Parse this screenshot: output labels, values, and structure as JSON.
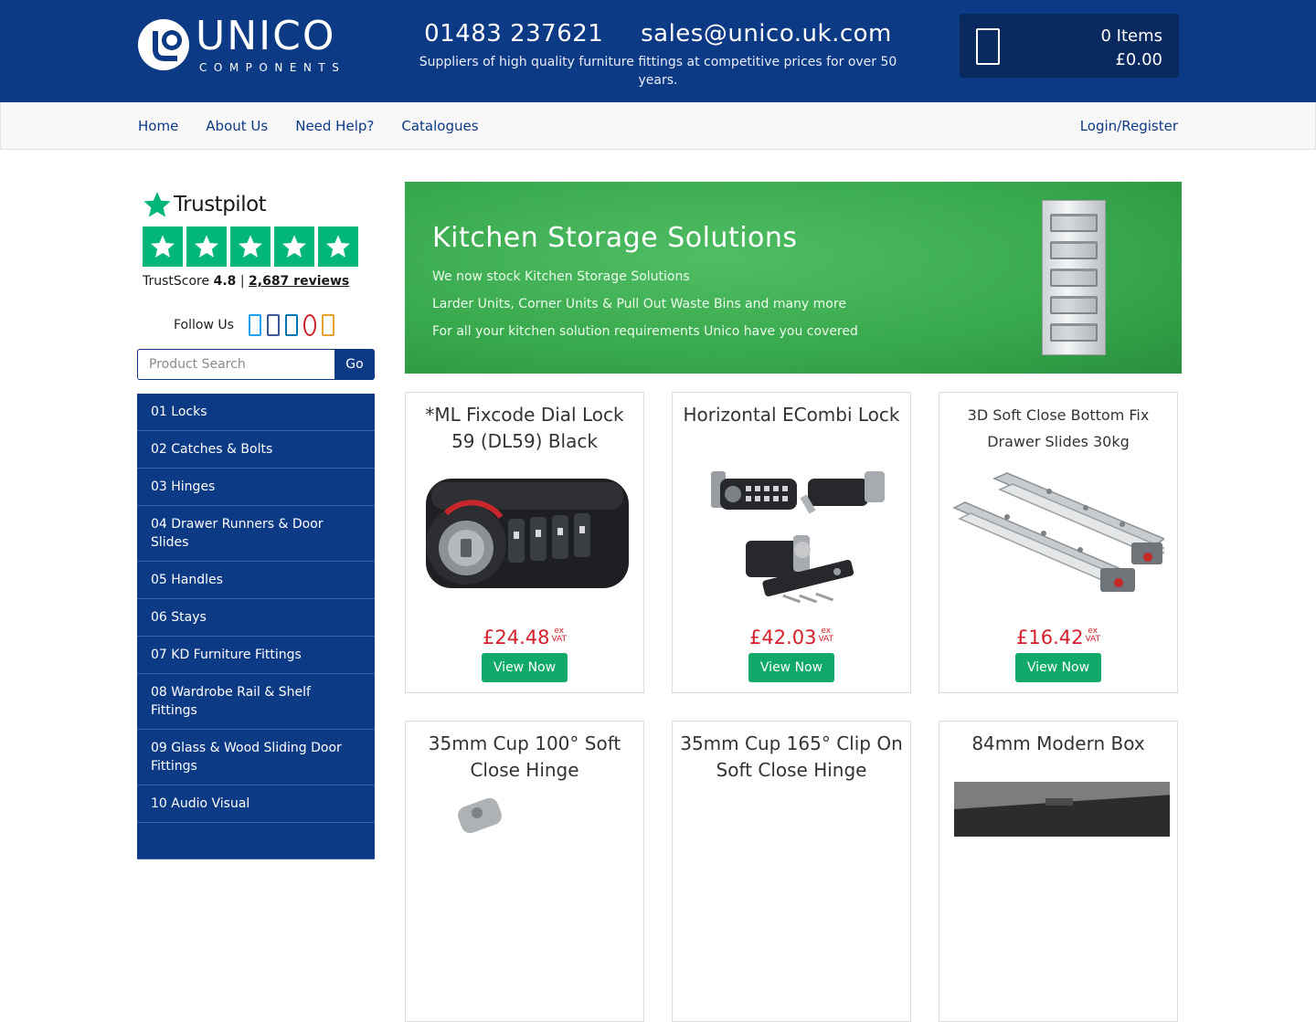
{
  "header": {
    "logo_word": "UNICO",
    "logo_sub": "COMPONENTS",
    "phone": "01483 237621",
    "email": "sales@unico.uk.com",
    "tagline": "Suppliers of high quality furniture fittings at competitive prices for over 50 years.",
    "basket_items": "0 Items",
    "basket_total": "£0.00",
    "cart_icon": "shopping-cart-icon"
  },
  "nav": {
    "links": [
      "Home",
      "About Us",
      "Need Help?",
      "Catalogues"
    ],
    "login": "Login/Register"
  },
  "sidebar": {
    "trustpilot": {
      "name": "Trustpilot",
      "score_label": "TrustScore",
      "score": "4.8",
      "separator": "|",
      "reviews": "2,687 reviews",
      "rating_stars": 5
    },
    "follow_label": "Follow Us",
    "social_icons": [
      "twitter-icon",
      "facebook-icon",
      "linkedin-icon",
      "pinterest-icon",
      "instagram-icon"
    ],
    "social_colors": [
      "#1da1f2",
      "#3b5998",
      "#0077b5",
      "#cb2027",
      "#e8a22c"
    ],
    "search": {
      "placeholder": "Product Search",
      "button": "Go"
    },
    "categories": [
      "01 Locks",
      "02 Catches & Bolts",
      "03 Hinges",
      "04 Drawer Runners & Door Slides",
      "05 Handles",
      "06 Stays",
      "07 KD Furniture Fittings",
      "08 Wardrobe Rail & Shelf Fittings",
      "09 Glass & Wood Sliding Door Fittings",
      "10 Audio Visual",
      ""
    ]
  },
  "banner": {
    "title": "Kitchen Storage Solutions",
    "lines": [
      "We now stock Kitchen Storage Solutions",
      "Larder Units, Corner Units & Pull Out Waste Bins and many more",
      "For all your kitchen solution requirements Unico have you covered"
    ]
  },
  "products": [
    {
      "title": "*ML Fixcode Dial Lock 59 (DL59) Black",
      "price": "£24.48",
      "vat_top": "ex",
      "vat_bottom": "VAT",
      "button": "View Now"
    },
    {
      "title": "Horizontal ECombi Lock",
      "price": "£42.03",
      "vat_top": "ex",
      "vat_bottom": "VAT",
      "button": "View Now"
    },
    {
      "title": "3D Soft Close Bottom Fix Drawer Slides 30kg",
      "price": "£16.42",
      "vat_top": "ex",
      "vat_bottom": "VAT",
      "button": "View Now"
    },
    {
      "title": "35mm Cup 100° Soft Close Hinge"
    },
    {
      "title": "35mm Cup 165° Clip On Soft Close Hinge"
    },
    {
      "title": "84mm Modern Box"
    }
  ],
  "colors": {
    "brand_blue": "#0d3a85",
    "price_red": "#d4202a",
    "button_green": "#0faa6a",
    "trustpilot_green": "#00b67a",
    "banner_green": "#38a84d"
  }
}
